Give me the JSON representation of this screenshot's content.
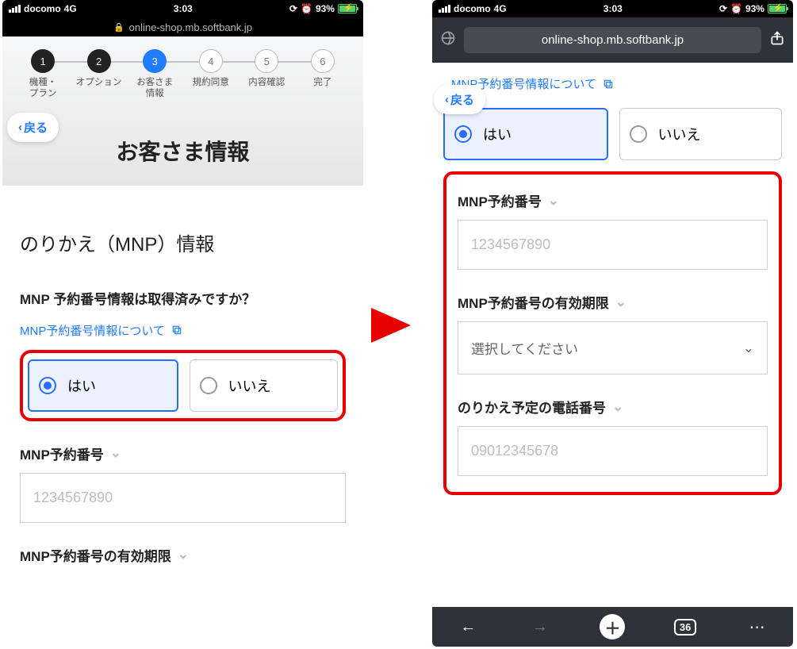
{
  "status": {
    "carrier": "docomo",
    "net": "4G",
    "time": "3:03",
    "battery": "93%"
  },
  "left": {
    "url": "online-shop.mb.softbank.jp",
    "back": "戻る",
    "wizard": [
      {
        "n": "1",
        "label": "機種・\nプラン",
        "state": "done"
      },
      {
        "n": "2",
        "label": "オプション",
        "state": "done"
      },
      {
        "n": "3",
        "label": "お客さま\n情報",
        "state": "active"
      },
      {
        "n": "4",
        "label": "規約同意",
        "state": "future"
      },
      {
        "n": "5",
        "label": "内容確認",
        "state": "future"
      },
      {
        "n": "6",
        "label": "完了",
        "state": "future"
      }
    ],
    "title": "お客さま情報",
    "section": "のりかえ（MNP）情報",
    "question": "MNP 予約番号情報は取得済みですか？",
    "link": "MNP予約番号情報について",
    "yes": "はい",
    "no": "いいえ",
    "f1": "MNP予約番号",
    "f1_ph": "1234567890",
    "f2": "MNP予約番号の有効期限"
  },
  "right": {
    "url": "online-shop.mb.softbank.jp",
    "link": "MNP予約番号情報について",
    "back": "戻る",
    "yes": "はい",
    "no": "いいえ",
    "f1": "MNP予約番号",
    "f1_ph": "1234567890",
    "f2": "MNP予約番号の有効期限",
    "f2_ph": "選択してください",
    "f3": "のりかえ予定の電話番号",
    "f3_ph": "09012345678",
    "tabs": "36"
  }
}
